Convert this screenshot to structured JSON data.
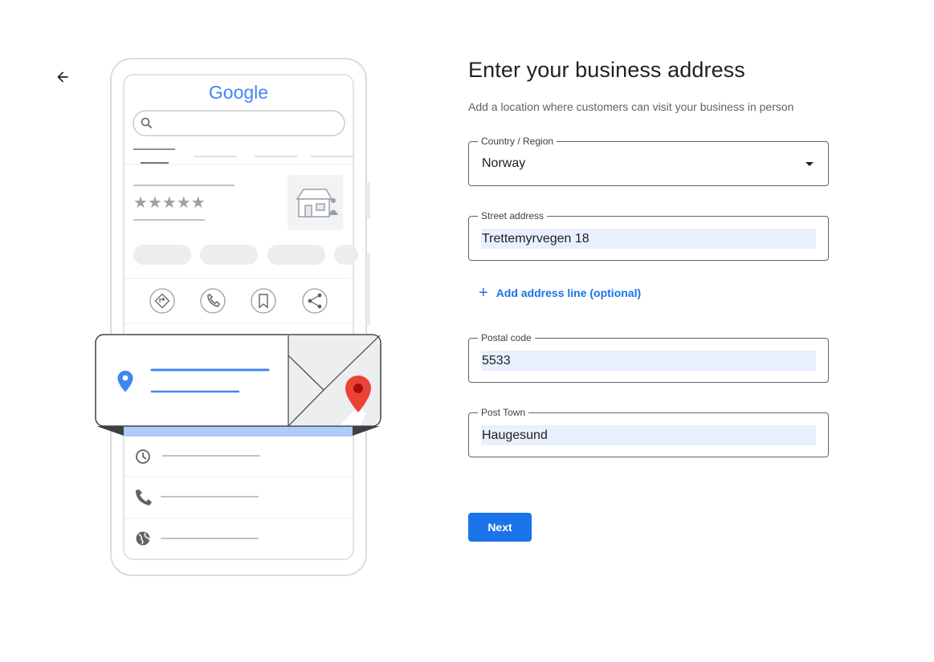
{
  "header": {
    "title": "Enter your business address",
    "subtitle": "Add a location where customers can visit your business in person"
  },
  "illustration": {
    "logo_text": "Google"
  },
  "form": {
    "country": {
      "label": "Country / Region",
      "value": "Norway"
    },
    "street": {
      "label": "Street address",
      "value": "Trettemyrvegen 18"
    },
    "add_line_label": "Add address line (optional)",
    "postal": {
      "label": "Postal code",
      "value": "5533"
    },
    "town": {
      "label": "Post Town",
      "value": "Haugesund"
    }
  },
  "actions": {
    "next_label": "Next"
  },
  "icons": {
    "back": "arrow-left-icon",
    "dropdown": "caret-down-icon",
    "add": "plus-icon"
  },
  "colors": {
    "accent": "#1a73e8",
    "autofill_bg": "#e8f0fe",
    "text": "#202124",
    "muted": "#5f6368"
  }
}
